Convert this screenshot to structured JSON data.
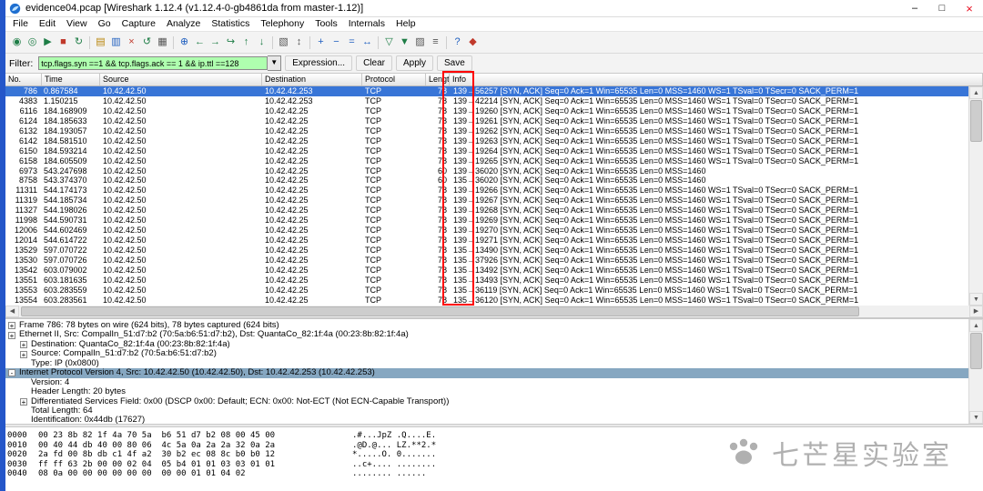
{
  "colors": {
    "selection_blue": "#3875d7",
    "filter_valid_green": "#afffaf",
    "highlight_red": "#ff0000",
    "detail_selected": "#86a7c1",
    "close_button_red": "#e81123",
    "edge_strip_blue": "#2456c9"
  },
  "window": {
    "title": "evidence04.pcap  [Wireshark 1.12.4  (v1.12.4-0-gb4861da from master-1.12)]",
    "controls": {
      "minimize": "–",
      "maximize": "□",
      "close": "×"
    }
  },
  "menu": {
    "items": [
      {
        "name": "menu-file",
        "label": "File"
      },
      {
        "name": "menu-edit",
        "label": "Edit"
      },
      {
        "name": "menu-view",
        "label": "View"
      },
      {
        "name": "menu-go",
        "label": "Go"
      },
      {
        "name": "menu-capture",
        "label": "Capture"
      },
      {
        "name": "menu-analyze",
        "label": "Analyze"
      },
      {
        "name": "menu-statistics",
        "label": "Statistics"
      },
      {
        "name": "menu-telephony",
        "label": "Telephony"
      },
      {
        "name": "menu-tools",
        "label": "Tools"
      },
      {
        "name": "menu-internals",
        "label": "Internals"
      },
      {
        "name": "menu-help",
        "label": "Help"
      }
    ]
  },
  "toolbar": {
    "icons": [
      {
        "name": "interfaces-icon",
        "glyph": "◉",
        "cls": "tbi c-g"
      },
      {
        "name": "capture-options-icon",
        "glyph": "◎",
        "cls": "tbi c-g"
      },
      {
        "name": "capture-start-icon",
        "glyph": "▶",
        "cls": "tbi c-g"
      },
      {
        "name": "capture-stop-icon",
        "glyph": "■",
        "cls": "tbi c-r"
      },
      {
        "name": "capture-restart-icon",
        "glyph": "↻",
        "cls": "tbi c-g"
      },
      {
        "name": "toolbar-separator",
        "glyph": "",
        "cls": "tbsep"
      },
      {
        "name": "open-file-icon",
        "glyph": "▤",
        "cls": "tbi c-y"
      },
      {
        "name": "save-file-icon",
        "glyph": "▥",
        "cls": "tbi c-b"
      },
      {
        "name": "close-file-icon",
        "glyph": "×",
        "cls": "tbi c-r"
      },
      {
        "name": "reload-icon",
        "glyph": "↺",
        "cls": "tbi c-g"
      },
      {
        "name": "print-icon",
        "glyph": "▦",
        "cls": "tbi c-k"
      },
      {
        "name": "toolbar-separator",
        "glyph": "",
        "cls": "tbsep"
      },
      {
        "name": "find-packet-icon",
        "glyph": "⊕",
        "cls": "tbi c-b"
      },
      {
        "name": "go-back-icon",
        "glyph": "←",
        "cls": "tbi c-g"
      },
      {
        "name": "go-forward-icon",
        "glyph": "→",
        "cls": "tbi c-g"
      },
      {
        "name": "go-to-packet-icon",
        "glyph": "↪",
        "cls": "tbi c-g"
      },
      {
        "name": "go-top-icon",
        "glyph": "↑",
        "cls": "tbi c-g"
      },
      {
        "name": "go-bottom-icon",
        "glyph": "↓",
        "cls": "tbi c-g"
      },
      {
        "name": "toolbar-separator",
        "glyph": "",
        "cls": "tbsep"
      },
      {
        "name": "colorize-icon",
        "glyph": "▧",
        "cls": "tbi c-k"
      },
      {
        "name": "autoscroll-icon",
        "glyph": "↕",
        "cls": "tbi c-k"
      },
      {
        "name": "toolbar-separator",
        "glyph": "",
        "cls": "tbsep"
      },
      {
        "name": "zoom-in-icon",
        "glyph": "+",
        "cls": "tbi c-b"
      },
      {
        "name": "zoom-out-icon",
        "glyph": "−",
        "cls": "tbi c-b"
      },
      {
        "name": "zoom-100-icon",
        "glyph": "=",
        "cls": "tbi c-b"
      },
      {
        "name": "resize-columns-icon",
        "glyph": "↔",
        "cls": "tbi c-b"
      },
      {
        "name": "toolbar-separator",
        "glyph": "",
        "cls": "tbsep"
      },
      {
        "name": "capture-filter-icon",
        "glyph": "▽",
        "cls": "tbi c-g"
      },
      {
        "name": "display-filter-icon",
        "glyph": "▼",
        "cls": "tbi c-g"
      },
      {
        "name": "coloring-rules-icon",
        "glyph": "▨",
        "cls": "tbi c-k"
      },
      {
        "name": "preferences-icon",
        "glyph": "≡",
        "cls": "tbi c-k"
      },
      {
        "name": "toolbar-separator",
        "glyph": "",
        "cls": "tbsep"
      },
      {
        "name": "help-icon",
        "glyph": "?",
        "cls": "tbi c-b"
      },
      {
        "name": "capture-filters-icon",
        "glyph": "◆",
        "cls": "tbi c-r"
      }
    ]
  },
  "filter": {
    "label": "Filter:",
    "value": "tcp.flags.syn ==1 && tcp.flags.ack == 1 && ip.ttl ==128",
    "dropdown_glyph": "▼",
    "buttons": [
      {
        "name": "expression-button",
        "label": "Expression..."
      },
      {
        "name": "clear-button",
        "label": "Clear"
      },
      {
        "name": "apply-button",
        "label": "Apply"
      },
      {
        "name": "save-button",
        "label": "Save"
      }
    ]
  },
  "packet_list": {
    "columns": [
      {
        "label": "No."
      },
      {
        "label": "Time"
      },
      {
        "label": "Source"
      },
      {
        "label": "Destination"
      },
      {
        "label": "Protocol"
      },
      {
        "label": "Length"
      },
      {
        "label": "Info"
      }
    ],
    "rows": [
      {
        "variant": "sel",
        "no": "786",
        "time": "0.867584",
        "src": "10.42.42.50",
        "dst": "10.42.42.253",
        "proto": "TCP",
        "len": "78",
        "info": "139→56257 [SYN, ACK] Seq=0 Ack=1 Win=65535 Len=0 MSS=1460 WS=1 TSval=0 TSecr=0 SACK_PERM=1"
      },
      {
        "variant": "",
        "no": "4383",
        "time": "1.150215",
        "src": "10.42.42.50",
        "dst": "10.42.42.253",
        "proto": "TCP",
        "len": "78",
        "info": "139→42214 [SYN, ACK] Seq=0 Ack=1 Win=65535 Len=0 MSS=1460 WS=1 TSval=0 TSecr=0 SACK_PERM=1"
      },
      {
        "variant": "",
        "no": "6116",
        "time": "184.168909",
        "src": "10.42.42.50",
        "dst": "10.42.42.25",
        "proto": "TCP",
        "len": "78",
        "info": "139→19260 [SYN, ACK] Seq=0 Ack=1 Win=65535 Len=0 MSS=1460 WS=1 TSval=0 TSecr=0 SACK_PERM=1"
      },
      {
        "variant": "",
        "no": "6124",
        "time": "184.185633",
        "src": "10.42.42.50",
        "dst": "10.42.42.25",
        "proto": "TCP",
        "len": "78",
        "info": "139→19261 [SYN, ACK] Seq=0 Ack=1 Win=65535 Len=0 MSS=1460 WS=1 TSval=0 TSecr=0 SACK_PERM=1"
      },
      {
        "variant": "",
        "no": "6132",
        "time": "184.193057",
        "src": "10.42.42.50",
        "dst": "10.42.42.25",
        "proto": "TCP",
        "len": "78",
        "info": "139→19262 [SYN, ACK] Seq=0 Ack=1 Win=65535 Len=0 MSS=1460 WS=1 TSval=0 TSecr=0 SACK_PERM=1"
      },
      {
        "variant": "",
        "no": "6142",
        "time": "184.581510",
        "src": "10.42.42.50",
        "dst": "10.42.42.25",
        "proto": "TCP",
        "len": "78",
        "info": "139→19263 [SYN, ACK] Seq=0 Ack=1 Win=65535 Len=0 MSS=1460 WS=1 TSval=0 TSecr=0 SACK_PERM=1"
      },
      {
        "variant": "",
        "no": "6150",
        "time": "184.593214",
        "src": "10.42.42.50",
        "dst": "10.42.42.25",
        "proto": "TCP",
        "len": "78",
        "info": "139→19264 [SYN, ACK] Seq=0 Ack=1 Win=65535 Len=0 MSS=1460 WS=1 TSval=0 TSecr=0 SACK_PERM=1"
      },
      {
        "variant": "",
        "no": "6158",
        "time": "184.605509",
        "src": "10.42.42.50",
        "dst": "10.42.42.25",
        "proto": "TCP",
        "len": "78",
        "info": "139→19265 [SYN, ACK] Seq=0 Ack=1 Win=65535 Len=0 MSS=1460 WS=1 TSval=0 TSecr=0 SACK_PERM=1"
      },
      {
        "variant": "",
        "no": "6973",
        "time": "543.247698",
        "src": "10.42.42.50",
        "dst": "10.42.42.25",
        "proto": "TCP",
        "len": "60",
        "info": "139→36020 [SYN, ACK] Seq=0 Ack=1 Win=65535 Len=0 MSS=1460"
      },
      {
        "variant": "",
        "no": "8758",
        "time": "543.374370",
        "src": "10.42.42.50",
        "dst": "10.42.42.25",
        "proto": "TCP",
        "len": "60",
        "info": "135→36020 [SYN, ACK] Seq=0 Ack=1 Win=65535 Len=0 MSS=1460"
      },
      {
        "variant": "",
        "no": "11311",
        "time": "544.174173",
        "src": "10.42.42.50",
        "dst": "10.42.42.25",
        "proto": "TCP",
        "len": "78",
        "info": "139→19266 [SYN, ACK] Seq=0 Ack=1 Win=65535 Len=0 MSS=1460 WS=1 TSval=0 TSecr=0 SACK_PERM=1"
      },
      {
        "variant": "",
        "no": "11319",
        "time": "544.185734",
        "src": "10.42.42.50",
        "dst": "10.42.42.25",
        "proto": "TCP",
        "len": "78",
        "info": "139→19267 [SYN, ACK] Seq=0 Ack=1 Win=65535 Len=0 MSS=1460 WS=1 TSval=0 TSecr=0 SACK_PERM=1"
      },
      {
        "variant": "",
        "no": "11327",
        "time": "544.198026",
        "src": "10.42.42.50",
        "dst": "10.42.42.25",
        "proto": "TCP",
        "len": "78",
        "info": "139→19268 [SYN, ACK] Seq=0 Ack=1 Win=65535 Len=0 MSS=1460 WS=1 TSval=0 TSecr=0 SACK_PERM=1"
      },
      {
        "variant": "",
        "no": "11998",
        "time": "544.590731",
        "src": "10.42.42.50",
        "dst": "10.42.42.25",
        "proto": "TCP",
        "len": "78",
        "info": "139→19269 [SYN, ACK] Seq=0 Ack=1 Win=65535 Len=0 MSS=1460 WS=1 TSval=0 TSecr=0 SACK_PERM=1"
      },
      {
        "variant": "",
        "no": "12006",
        "time": "544.602469",
        "src": "10.42.42.50",
        "dst": "10.42.42.25",
        "proto": "TCP",
        "len": "78",
        "info": "139→19270 [SYN, ACK] Seq=0 Ack=1 Win=65535 Len=0 MSS=1460 WS=1 TSval=0 TSecr=0 SACK_PERM=1"
      },
      {
        "variant": "",
        "no": "12014",
        "time": "544.614722",
        "src": "10.42.42.50",
        "dst": "10.42.42.25",
        "proto": "TCP",
        "len": "78",
        "info": "139→19271 [SYN, ACK] Seq=0 Ack=1 Win=65535 Len=0 MSS=1460 WS=1 TSval=0 TSecr=0 SACK_PERM=1"
      },
      {
        "variant": "",
        "no": "13529",
        "time": "597.070722",
        "src": "10.42.42.50",
        "dst": "10.42.42.25",
        "proto": "TCP",
        "len": "78",
        "info": "135→13490 [SYN, ACK] Seq=0 Ack=1 Win=65535 Len=0 MSS=1460 WS=1 TSval=0 TSecr=0 SACK_PERM=1"
      },
      {
        "variant": "",
        "no": "13530",
        "time": "597.070726",
        "src": "10.42.42.50",
        "dst": "10.42.42.25",
        "proto": "TCP",
        "len": "78",
        "info": "135→37926 [SYN, ACK] Seq=0 Ack=1 Win=65535 Len=0 MSS=1460 WS=1 TSval=0 TSecr=0 SACK_PERM=1"
      },
      {
        "variant": "",
        "no": "13542",
        "time": "603.079002",
        "src": "10.42.42.50",
        "dst": "10.42.42.25",
        "proto": "TCP",
        "len": "78",
        "info": "135→13492 [SYN, ACK] Seq=0 Ack=1 Win=65535 Len=0 MSS=1460 WS=1 TSval=0 TSecr=0 SACK_PERM=1"
      },
      {
        "variant": "",
        "no": "13551",
        "time": "603.181635",
        "src": "10.42.42.50",
        "dst": "10.42.42.25",
        "proto": "TCP",
        "len": "78",
        "info": "135→13493 [SYN, ACK] Seq=0 Ack=1 Win=65535 Len=0 MSS=1460 WS=1 TSval=0 TSecr=0 SACK_PERM=1"
      },
      {
        "variant": "",
        "no": "13553",
        "time": "603.283559",
        "src": "10.42.42.50",
        "dst": "10.42.42.25",
        "proto": "TCP",
        "len": "78",
        "info": "135→36119 [SYN, ACK] Seq=0 Ack=1 Win=65535 Len=0 MSS=1460 WS=1 TSval=0 TSecr=0 SACK_PERM=1"
      },
      {
        "variant": "",
        "no": "13554",
        "time": "603.283561",
        "src": "10.42.42.50",
        "dst": "10.42.42.25",
        "proto": "TCP",
        "len": "78",
        "info": "135→36120 [SYN, ACK] Seq=0 Ack=1 Win=65535 Len=0 MSS=1460 WS=1 TSval=0 TSecr=0 SACK_PERM=1"
      }
    ]
  },
  "details": {
    "lines": [
      {
        "variant": "",
        "exp": "+",
        "indent": "0",
        "text": "Frame 786: 78 bytes on wire (624 bits), 78 bytes captured (624 bits)"
      },
      {
        "variant": "",
        "exp": "+",
        "indent": "0",
        "text": "Ethernet II, Src: CompalIn_51:d7:b2 (70:5a:b6:51:d7:b2), Dst: QuantaCo_82:1f:4a (00:23:8b:82:1f:4a)"
      },
      {
        "variant": "",
        "exp": "+",
        "indent": "1",
        "text": "Destination: QuantaCo_82:1f:4a (00:23:8b:82:1f:4a)"
      },
      {
        "variant": "",
        "exp": "+",
        "indent": "1",
        "text": "Source: CompalIn_51:d7:b2 (70:5a:b6:51:d7:b2)"
      },
      {
        "variant": "",
        "exp": "",
        "indent": "1",
        "text": "Type: IP (0x0800)"
      },
      {
        "variant": "sel",
        "exp": "-",
        "indent": "0",
        "text": "Internet Protocol Version 4, Src: 10.42.42.50 (10.42.42.50), Dst: 10.42.42.253 (10.42.42.253)"
      },
      {
        "variant": "",
        "exp": "",
        "indent": "1",
        "text": "Version: 4"
      },
      {
        "variant": "",
        "exp": "",
        "indent": "1",
        "text": "Header Length: 20 bytes"
      },
      {
        "variant": "",
        "exp": "+",
        "indent": "1",
        "text": "Differentiated Services Field: 0x00 (DSCP 0x00: Default; ECN: 0x00: Not-ECT (Not ECN-Capable Transport))"
      },
      {
        "variant": "",
        "exp": "",
        "indent": "1",
        "text": "Total Length: 64"
      },
      {
        "variant": "",
        "exp": "",
        "indent": "1",
        "text": "Identification: 0x44db (17627)"
      }
    ]
  },
  "hex": {
    "rows": [
      {
        "offset": "0000",
        "bytes": "00 23 8b 82 1f 4a 70 5a  b6 51 d7 b2 08 00 45 00",
        "ascii": ".#...JpZ .Q....E."
      },
      {
        "offset": "0010",
        "bytes": "00 40 44 db 40 00 80 06  4c 5a 0a 2a 2a 32 0a 2a",
        "ascii": ".@D.@... LZ.**2.*"
      },
      {
        "offset": "0020",
        "bytes": "2a fd 00 8b db c1 4f a2  30 b2 ec 08 8c b0 b0 12",
        "ascii": "*.....O. 0......."
      },
      {
        "offset": "0030",
        "bytes": "ff ff 63 2b 00 00 02 04  05 b4 01 01 03 03 01 01",
        "ascii": "..c+.... ........"
      },
      {
        "offset": "0040",
        "bytes": "08 0a 00 00 00 00 00 00  00 00 01 01 04 02",
        "ascii": "........ ......"
      }
    ]
  },
  "scrollbar": {
    "up": "▲",
    "down": "▼",
    "left": "◀",
    "right": "▶"
  },
  "watermark": {
    "text": "七芒星实验室"
  }
}
